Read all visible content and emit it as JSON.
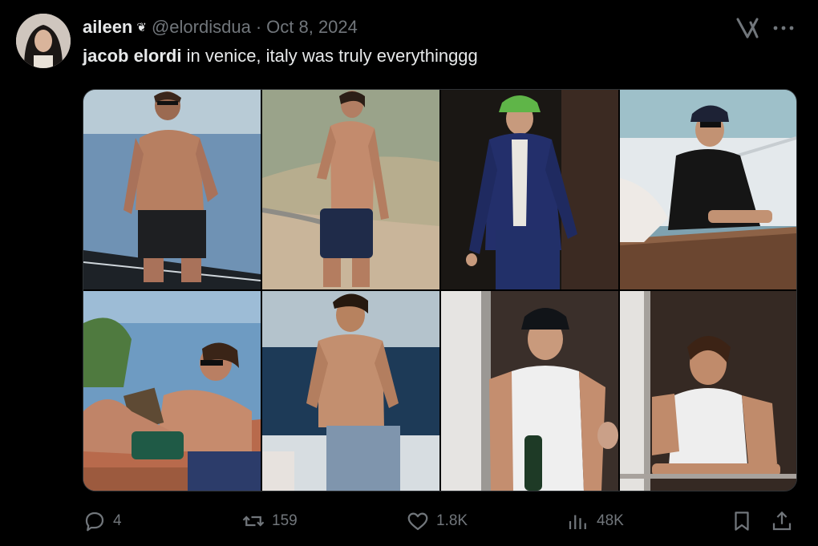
{
  "tweet": {
    "author": {
      "display_name": "aileen",
      "badge_glyph": "❦",
      "handle": "@elordisdua",
      "separator": "·",
      "date": "Oct 8, 2024"
    },
    "text": {
      "bold": "jacob elordi",
      "rest": " in venice, italy was truly everythinggg"
    }
  },
  "media": {
    "photo_count": 8,
    "rows": 2,
    "columns": 4
  },
  "actions": {
    "replies": "4",
    "reposts": "159",
    "likes": "1.8K",
    "views": "48K"
  },
  "icons": {
    "header": [
      "grok-icon",
      "more-icon"
    ],
    "actions": [
      "reply-icon",
      "repost-icon",
      "like-icon",
      "views-icon",
      "bookmark-icon",
      "share-icon"
    ]
  },
  "colors": {
    "background": "#000000",
    "primary_text": "#e7e9ea",
    "secondary_text": "#71767b",
    "border": "#2f3336"
  }
}
